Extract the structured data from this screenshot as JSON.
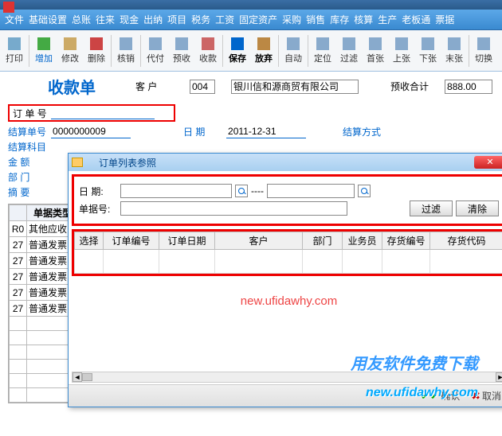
{
  "menu": [
    "文件",
    "基础设置",
    "总账",
    "往来",
    "现金",
    "出纳",
    "项目",
    "税务",
    "工资",
    "固定资产",
    "采购",
    "销售",
    "库存",
    "核算",
    "生产",
    "老板通",
    "票据"
  ],
  "toolbar": {
    "print": "打印",
    "add": "增加",
    "edit": "修改",
    "delete": "删除",
    "audit": "核销",
    "pay": "代付",
    "prepay": "预收",
    "receipt": "收款",
    "save": "保存",
    "discard": "放弃",
    "auto": "自动",
    "locate": "定位",
    "filter": "过滤",
    "first": "首张",
    "prev": "上张",
    "next": "下张",
    "last": "末张",
    "switch": "切换"
  },
  "doc": {
    "title": "收款单",
    "customer_lbl": "客    户",
    "customer_code": "004",
    "customer_name": "银川信和源商贸有限公司",
    "pretotal_lbl": "预收合计",
    "pretotal_val": "888.00",
    "orderno_lbl": "订 单 号",
    "settleno_lbl": "结算单号",
    "settleno_val": "0000000009",
    "date_lbl": "日    期",
    "date_val": "2011-12-31",
    "settlemethod_lbl": "结算方式",
    "settleacct_lbl": "结算科目",
    "amount_lbl": "金    额",
    "dept_lbl": "部    门",
    "memo_lbl": "摘    要"
  },
  "table": {
    "h1": "",
    "h2": "单据类型",
    "rows": [
      {
        "n": "R0",
        "t": "其他应收"
      },
      {
        "n": "27",
        "t": "普通发票"
      },
      {
        "n": "27",
        "t": "普通发票"
      },
      {
        "n": "27",
        "t": "普通发票"
      },
      {
        "n": "27",
        "t": "普通发票"
      },
      {
        "n": "27",
        "t": "普通发票"
      }
    ]
  },
  "dialog": {
    "title": "订单列表参照",
    "date_lbl": "日  期:",
    "sep": "----",
    "docno_lbl": "单据号:",
    "filter_btn": "过滤",
    "clear_btn": "清除",
    "cols": [
      "选择",
      "订单编号",
      "订单日期",
      "客户",
      "部门",
      "业务员",
      "存货编号",
      "存货代码"
    ],
    "watermark": "new.ufidawhy.com",
    "ok": "确认",
    "cancel": "取消"
  },
  "brand": "用友软件免费下载",
  "brand_url": "new.ufidawhy.com"
}
